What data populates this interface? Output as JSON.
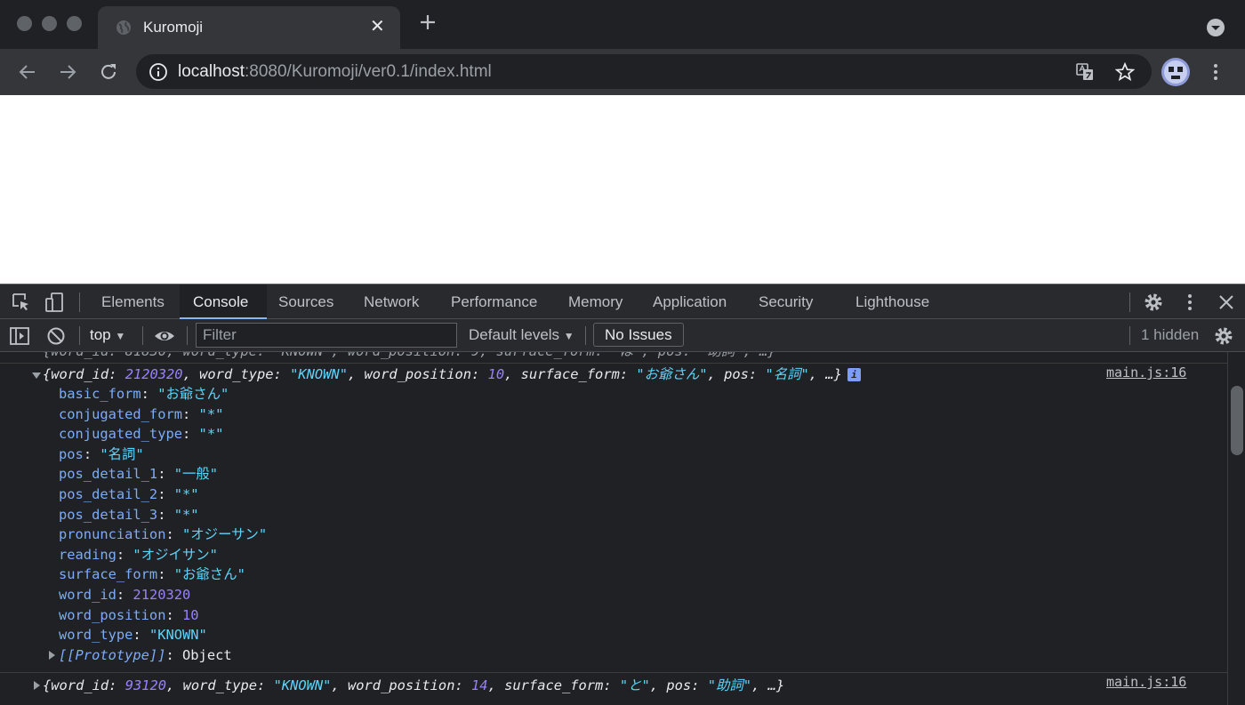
{
  "browser": {
    "tab": {
      "title": "Kuromoji",
      "close_glyph": "✕"
    },
    "address": {
      "host": "localhost",
      "rest": ":8080/Kuromoji/ver0.1/index.html"
    },
    "icons": {
      "favicon": "globe-icon",
      "new_tab": "plus-icon",
      "back": "arrow-left-icon",
      "forward": "arrow-right-icon",
      "reload": "reload-icon",
      "site_info": "info-circle-icon",
      "translate": "translate-icon",
      "bookmark": "star-icon",
      "menu": "kebab-menu-icon"
    }
  },
  "devtools": {
    "tabs": [
      {
        "label": "Elements"
      },
      {
        "label": "Console"
      },
      {
        "label": "Sources"
      },
      {
        "label": "Network"
      },
      {
        "label": "Performance"
      },
      {
        "label": "Memory"
      },
      {
        "label": "Application"
      },
      {
        "label": "Security"
      },
      {
        "label": "Lighthouse"
      }
    ],
    "active_tab": "Console",
    "toolbar": {
      "context": "top",
      "filter_placeholder": "Filter",
      "levels": "Default levels",
      "issues": "No Issues",
      "hidden": "1 hidden"
    }
  },
  "console": {
    "entries": [
      {
        "summary": "{word_id: 2120320, word_type: \"KNOWN\", word_position: 10, surface_form: \"お爺さん\", pos: \"名詞\", …}",
        "source": "main.js:16",
        "expanded": true,
        "properties": [
          {
            "key": "basic_form",
            "value": "\"お爺さん\""
          },
          {
            "key": "conjugated_form",
            "value": "\"*\""
          },
          {
            "key": "conjugated_type",
            "value": "\"*\""
          },
          {
            "key": "pos",
            "value": "\"名詞\""
          },
          {
            "key": "pos_detail_1",
            "value": "\"一般\""
          },
          {
            "key": "pos_detail_2",
            "value": "\"*\""
          },
          {
            "key": "pos_detail_3",
            "value": "\"*\""
          },
          {
            "key": "pronunciation",
            "value": "\"オジーサン\""
          },
          {
            "key": "reading",
            "value": "\"オジイサン\""
          },
          {
            "key": "surface_form",
            "value": "\"お爺さん\""
          },
          {
            "key": "word_id",
            "value": "2120320"
          },
          {
            "key": "word_position",
            "value": "10"
          },
          {
            "key": "word_type",
            "value": "\"KNOWN\""
          }
        ],
        "prototype": {
          "key": "[[Prototype]]",
          "value": "Object"
        }
      },
      {
        "summary": "{word_id: 93120, word_type: \"KNOWN\", word_position: 14, surface_form: \"と\", pos: \"助詞\", …}",
        "source": "main.js:16",
        "expanded": false
      }
    ]
  }
}
